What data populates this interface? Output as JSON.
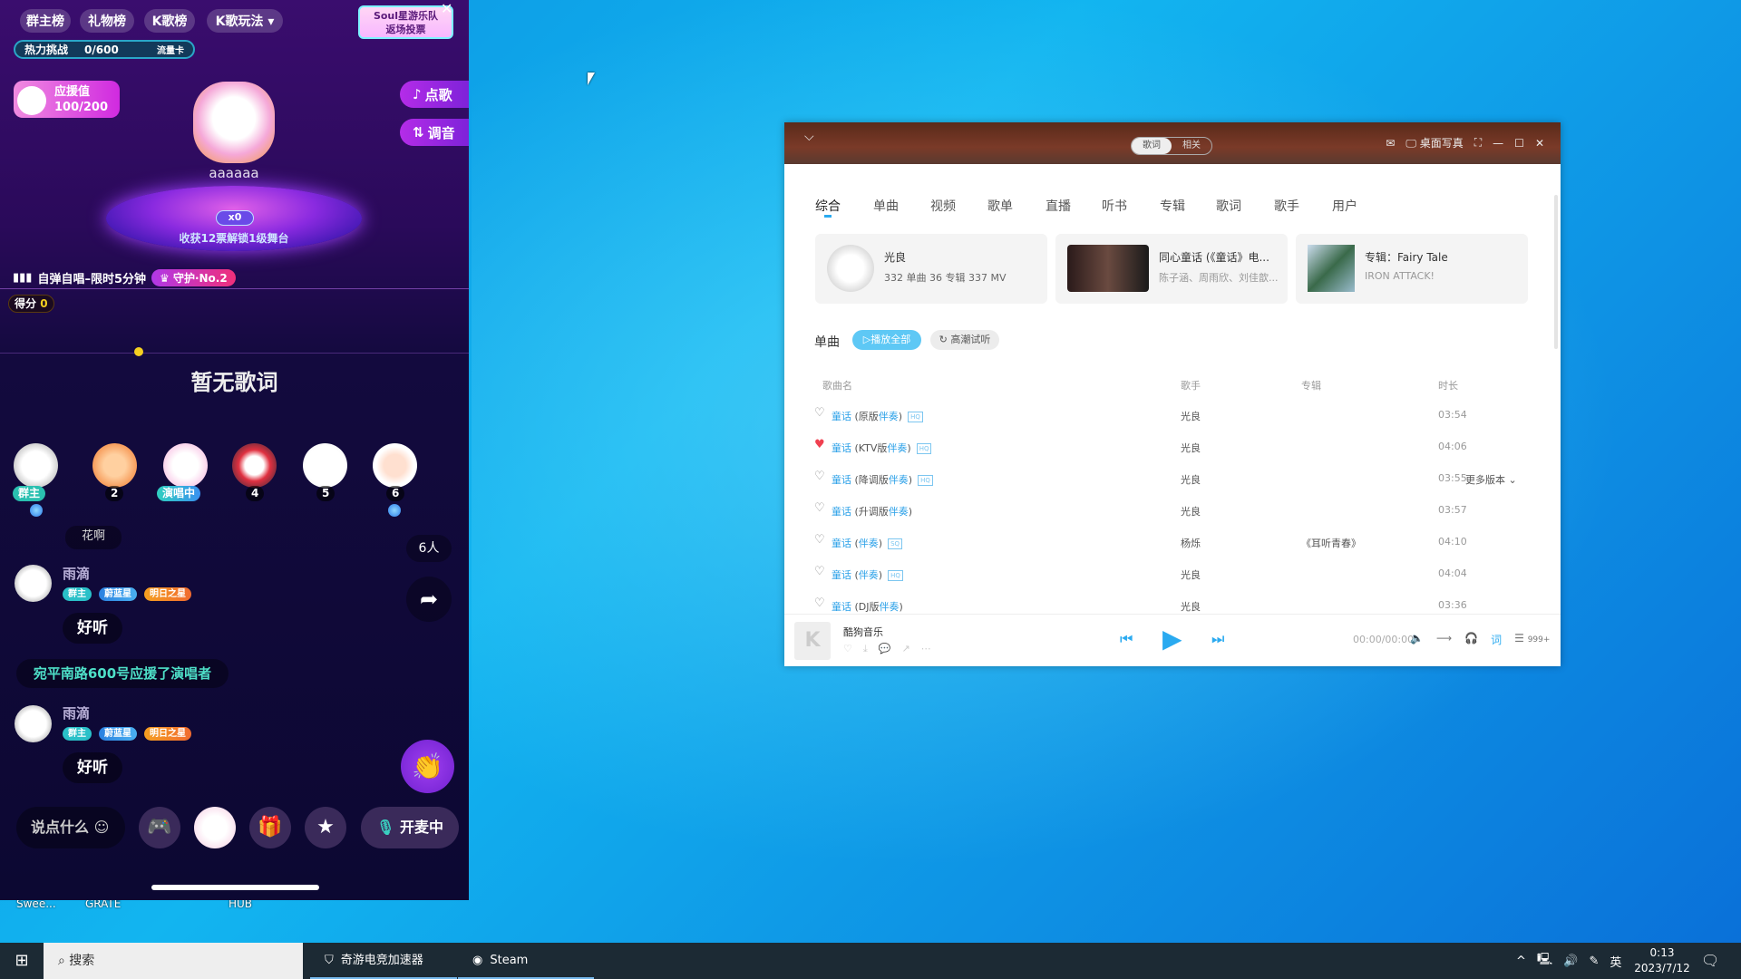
{
  "phone": {
    "top_tabs": [
      "群主榜",
      "礼物榜",
      "K歌榜",
      "K歌玩法 ▾"
    ],
    "banner": {
      "line1": "Soul星游乐队",
      "line2": "返场投票"
    },
    "heat": {
      "label": "热力挑战",
      "progress": "0/600",
      "card": "流量卡"
    },
    "support": {
      "label": "应援值",
      "value": "100/200"
    },
    "side_buttons": {
      "request": "点歌",
      "tune": "调音"
    },
    "stage": {
      "name": "aaaaaa",
      "votes": "x0",
      "unlock": "收获12票解锁1级舞台"
    },
    "mode": {
      "label": "自弹自唱–限时5分钟",
      "guard": "守护·No.2"
    },
    "score": {
      "label": "得分",
      "value": "0"
    },
    "no_lyrics": "暂无歌词",
    "seats": [
      {
        "label": "群主"
      },
      {
        "label": "2"
      },
      {
        "label": "演唱中"
      },
      {
        "label": "4"
      },
      {
        "label": "5"
      },
      {
        "label": "6"
      }
    ],
    "hidden_msg": "花啊",
    "online_count": "6人",
    "chat": [
      {
        "name": "雨滴",
        "badges": [
          "群主",
          "蔚蓝星",
          "明日之星"
        ],
        "text": "好听"
      },
      {
        "name": "雨滴",
        "badges": [
          "群主",
          "蔚蓝星",
          "明日之星"
        ],
        "text": "好听"
      }
    ],
    "system_msg": "宛平南路600号应援了演唱者",
    "input_placeholder": "说点什么",
    "mic_label": "开麦中"
  },
  "desktop_labels": [
    "Swee...",
    "GRATE",
    "HUB"
  ],
  "music": {
    "segment": [
      "歌词",
      "相关"
    ],
    "title_controls": {
      "desktop_photo": "桌面写真"
    },
    "tabs": [
      "综合",
      "单曲",
      "视频",
      "歌单",
      "直播",
      "听书",
      "专辑",
      "歌词",
      "歌手",
      "用户"
    ],
    "cards": [
      {
        "title": "光良",
        "sub": "332 单曲    36 专辑    337 MV"
      },
      {
        "title": "同心童话 (《童话》电...",
        "sub": "陈子涵、周雨欣、刘佳歆..."
      },
      {
        "title": "专辑：Fairy Tale",
        "sub": "IRON ATTACK!"
      }
    ],
    "section": {
      "label": "单曲",
      "play_all": "播放全部",
      "climax": "高潮试听"
    },
    "columns": [
      "歌曲名",
      "歌手",
      "专辑",
      "时长"
    ],
    "songs": [
      {
        "name": "童话",
        "ver": "(原版",
        "acc": "伴奏",
        ")": ")",
        "q": "HQ",
        "artist": "光良",
        "album": "",
        "dur": "03:54",
        "liked": false
      },
      {
        "name": "童话",
        "ver": "(KTV版",
        "acc": "伴奏",
        "q": "HQ",
        "artist": "光良",
        "album": "",
        "dur": "04:06",
        "liked": true
      },
      {
        "name": "童话",
        "ver": "(降调版",
        "acc": "伴奏",
        "q": "HQ",
        "artist": "光良",
        "album": "",
        "dur": "03:55",
        "liked": false,
        "more": "更多版本"
      },
      {
        "name": "童话",
        "ver": "(升调版",
        "acc": "伴奏",
        "q": "",
        "artist": "光良",
        "album": "",
        "dur": "03:57",
        "liked": false
      },
      {
        "name": "童话",
        "ver": "(",
        "acc": "伴奏",
        "q": "SQ",
        "artist": "杨烁",
        "album": "《耳听青春》",
        "dur": "04:10",
        "liked": false
      },
      {
        "name": "童话",
        "ver": "(",
        "acc": "伴奏",
        "q": "HQ",
        "artist": "光良",
        "album": "",
        "dur": "04:04",
        "liked": false
      },
      {
        "name": "童话",
        "ver": "(DJ版",
        "acc": "伴奏",
        "q": "",
        "artist": "光良",
        "album": "",
        "dur": "03:36",
        "liked": false
      }
    ],
    "player": {
      "name": "酷狗音乐",
      "time": "00:00/00:00",
      "lyric_btn": "词",
      "queue": "999+"
    }
  },
  "taskbar": {
    "search": "搜索",
    "apps": [
      "奇游电竞加速器",
      "Steam"
    ],
    "ime": "英",
    "time": "0:13",
    "date": "2023/7/12"
  }
}
